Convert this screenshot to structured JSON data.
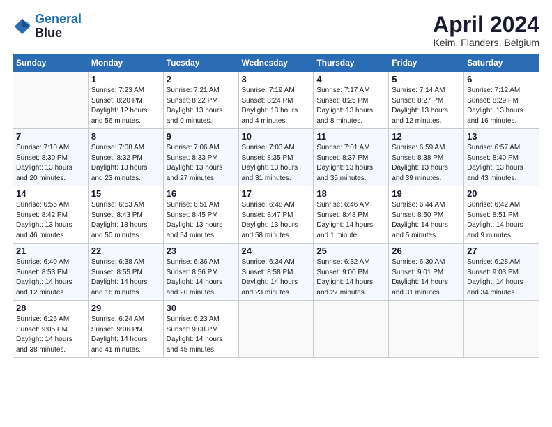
{
  "logo": {
    "line1": "General",
    "line2": "Blue"
  },
  "title": "April 2024",
  "subtitle": "Keim, Flanders, Belgium",
  "days_of_week": [
    "Sunday",
    "Monday",
    "Tuesday",
    "Wednesday",
    "Thursday",
    "Friday",
    "Saturday"
  ],
  "weeks": [
    [
      {
        "day": "",
        "info": ""
      },
      {
        "day": "1",
        "info": "Sunrise: 7:23 AM\nSunset: 8:20 PM\nDaylight: 12 hours\nand 56 minutes."
      },
      {
        "day": "2",
        "info": "Sunrise: 7:21 AM\nSunset: 8:22 PM\nDaylight: 13 hours\nand 0 minutes."
      },
      {
        "day": "3",
        "info": "Sunrise: 7:19 AM\nSunset: 8:24 PM\nDaylight: 13 hours\nand 4 minutes."
      },
      {
        "day": "4",
        "info": "Sunrise: 7:17 AM\nSunset: 8:25 PM\nDaylight: 13 hours\nand 8 minutes."
      },
      {
        "day": "5",
        "info": "Sunrise: 7:14 AM\nSunset: 8:27 PM\nDaylight: 13 hours\nand 12 minutes."
      },
      {
        "day": "6",
        "info": "Sunrise: 7:12 AM\nSunset: 8:29 PM\nDaylight: 13 hours\nand 16 minutes."
      }
    ],
    [
      {
        "day": "7",
        "info": "Sunrise: 7:10 AM\nSunset: 8:30 PM\nDaylight: 13 hours\nand 20 minutes."
      },
      {
        "day": "8",
        "info": "Sunrise: 7:08 AM\nSunset: 8:32 PM\nDaylight: 13 hours\nand 23 minutes."
      },
      {
        "day": "9",
        "info": "Sunrise: 7:06 AM\nSunset: 8:33 PM\nDaylight: 13 hours\nand 27 minutes."
      },
      {
        "day": "10",
        "info": "Sunrise: 7:03 AM\nSunset: 8:35 PM\nDaylight: 13 hours\nand 31 minutes."
      },
      {
        "day": "11",
        "info": "Sunrise: 7:01 AM\nSunset: 8:37 PM\nDaylight: 13 hours\nand 35 minutes."
      },
      {
        "day": "12",
        "info": "Sunrise: 6:59 AM\nSunset: 8:38 PM\nDaylight: 13 hours\nand 39 minutes."
      },
      {
        "day": "13",
        "info": "Sunrise: 6:57 AM\nSunset: 8:40 PM\nDaylight: 13 hours\nand 43 minutes."
      }
    ],
    [
      {
        "day": "14",
        "info": "Sunrise: 6:55 AM\nSunset: 8:42 PM\nDaylight: 13 hours\nand 46 minutes."
      },
      {
        "day": "15",
        "info": "Sunrise: 6:53 AM\nSunset: 8:43 PM\nDaylight: 13 hours\nand 50 minutes."
      },
      {
        "day": "16",
        "info": "Sunrise: 6:51 AM\nSunset: 8:45 PM\nDaylight: 13 hours\nand 54 minutes."
      },
      {
        "day": "17",
        "info": "Sunrise: 6:48 AM\nSunset: 8:47 PM\nDaylight: 13 hours\nand 58 minutes."
      },
      {
        "day": "18",
        "info": "Sunrise: 6:46 AM\nSunset: 8:48 PM\nDaylight: 14 hours\nand 1 minute."
      },
      {
        "day": "19",
        "info": "Sunrise: 6:44 AM\nSunset: 8:50 PM\nDaylight: 14 hours\nand 5 minutes."
      },
      {
        "day": "20",
        "info": "Sunrise: 6:42 AM\nSunset: 8:51 PM\nDaylight: 14 hours\nand 9 minutes."
      }
    ],
    [
      {
        "day": "21",
        "info": "Sunrise: 6:40 AM\nSunset: 8:53 PM\nDaylight: 14 hours\nand 12 minutes."
      },
      {
        "day": "22",
        "info": "Sunrise: 6:38 AM\nSunset: 8:55 PM\nDaylight: 14 hours\nand 16 minutes."
      },
      {
        "day": "23",
        "info": "Sunrise: 6:36 AM\nSunset: 8:56 PM\nDaylight: 14 hours\nand 20 minutes."
      },
      {
        "day": "24",
        "info": "Sunrise: 6:34 AM\nSunset: 8:58 PM\nDaylight: 14 hours\nand 23 minutes."
      },
      {
        "day": "25",
        "info": "Sunrise: 6:32 AM\nSunset: 9:00 PM\nDaylight: 14 hours\nand 27 minutes."
      },
      {
        "day": "26",
        "info": "Sunrise: 6:30 AM\nSunset: 9:01 PM\nDaylight: 14 hours\nand 31 minutes."
      },
      {
        "day": "27",
        "info": "Sunrise: 6:28 AM\nSunset: 9:03 PM\nDaylight: 14 hours\nand 34 minutes."
      }
    ],
    [
      {
        "day": "28",
        "info": "Sunrise: 6:26 AM\nSunset: 9:05 PM\nDaylight: 14 hours\nand 38 minutes."
      },
      {
        "day": "29",
        "info": "Sunrise: 6:24 AM\nSunset: 9:06 PM\nDaylight: 14 hours\nand 41 minutes."
      },
      {
        "day": "30",
        "info": "Sunrise: 6:23 AM\nSunset: 9:08 PM\nDaylight: 14 hours\nand 45 minutes."
      },
      {
        "day": "",
        "info": ""
      },
      {
        "day": "",
        "info": ""
      },
      {
        "day": "",
        "info": ""
      },
      {
        "day": "",
        "info": ""
      }
    ]
  ]
}
